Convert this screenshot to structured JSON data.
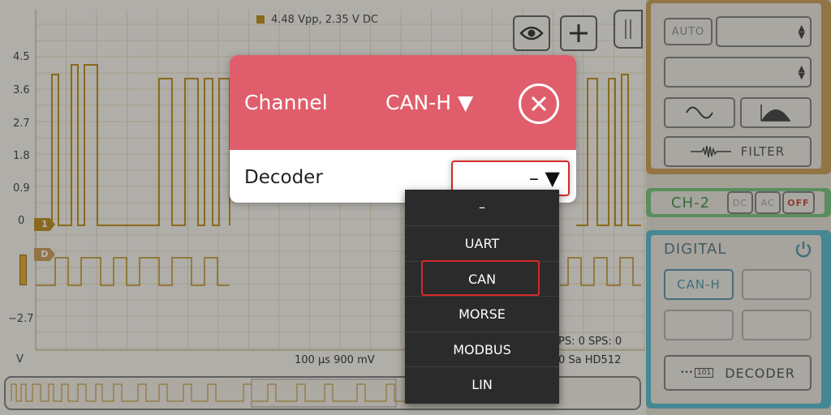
{
  "plot": {
    "measurement": "4.48 Vpp, 2.35 V DC",
    "y_ticks": [
      "4.5",
      "3.6",
      "2.7",
      "1.8",
      "0.9",
      "0",
      "−2.7"
    ],
    "y_unit": "V",
    "scale": "100 µs  900 mV",
    "sample_info": "0 Sa   HD512",
    "sps_info": "PS: 0   SPS: 0",
    "channel_marker": "1",
    "digital_marker": "D"
  },
  "panel": {
    "auto_label": "AUTO",
    "filter_label": "FILTER",
    "ch2_label": "CH-2",
    "dc_label": "DC",
    "ac_label": "AC",
    "off_label": "OFF",
    "digital_title": "DIGITAL",
    "can_h_label": "CAN-H",
    "decoder_label": "DECODER",
    "decoder_badge": "101"
  },
  "dialog": {
    "channel_label": "Channel",
    "channel_value": "CAN-H ▼",
    "decoder_label": "Decoder",
    "decoder_value": "–  ▼"
  },
  "dropdown": {
    "options": [
      "–",
      "UART",
      "CAN",
      "MORSE",
      "MODBUS",
      "LIN"
    ],
    "highlighted": "CAN"
  },
  "colors": {
    "trace": "#b8860b",
    "dialog_header": "#e05e6b",
    "highlight": "#d42a2a",
    "dropdown_bg": "#2b2b2b",
    "panel_teal": "#4bb5c8",
    "panel_green": "#6fbf73",
    "panel_orange": "#c9964a"
  }
}
